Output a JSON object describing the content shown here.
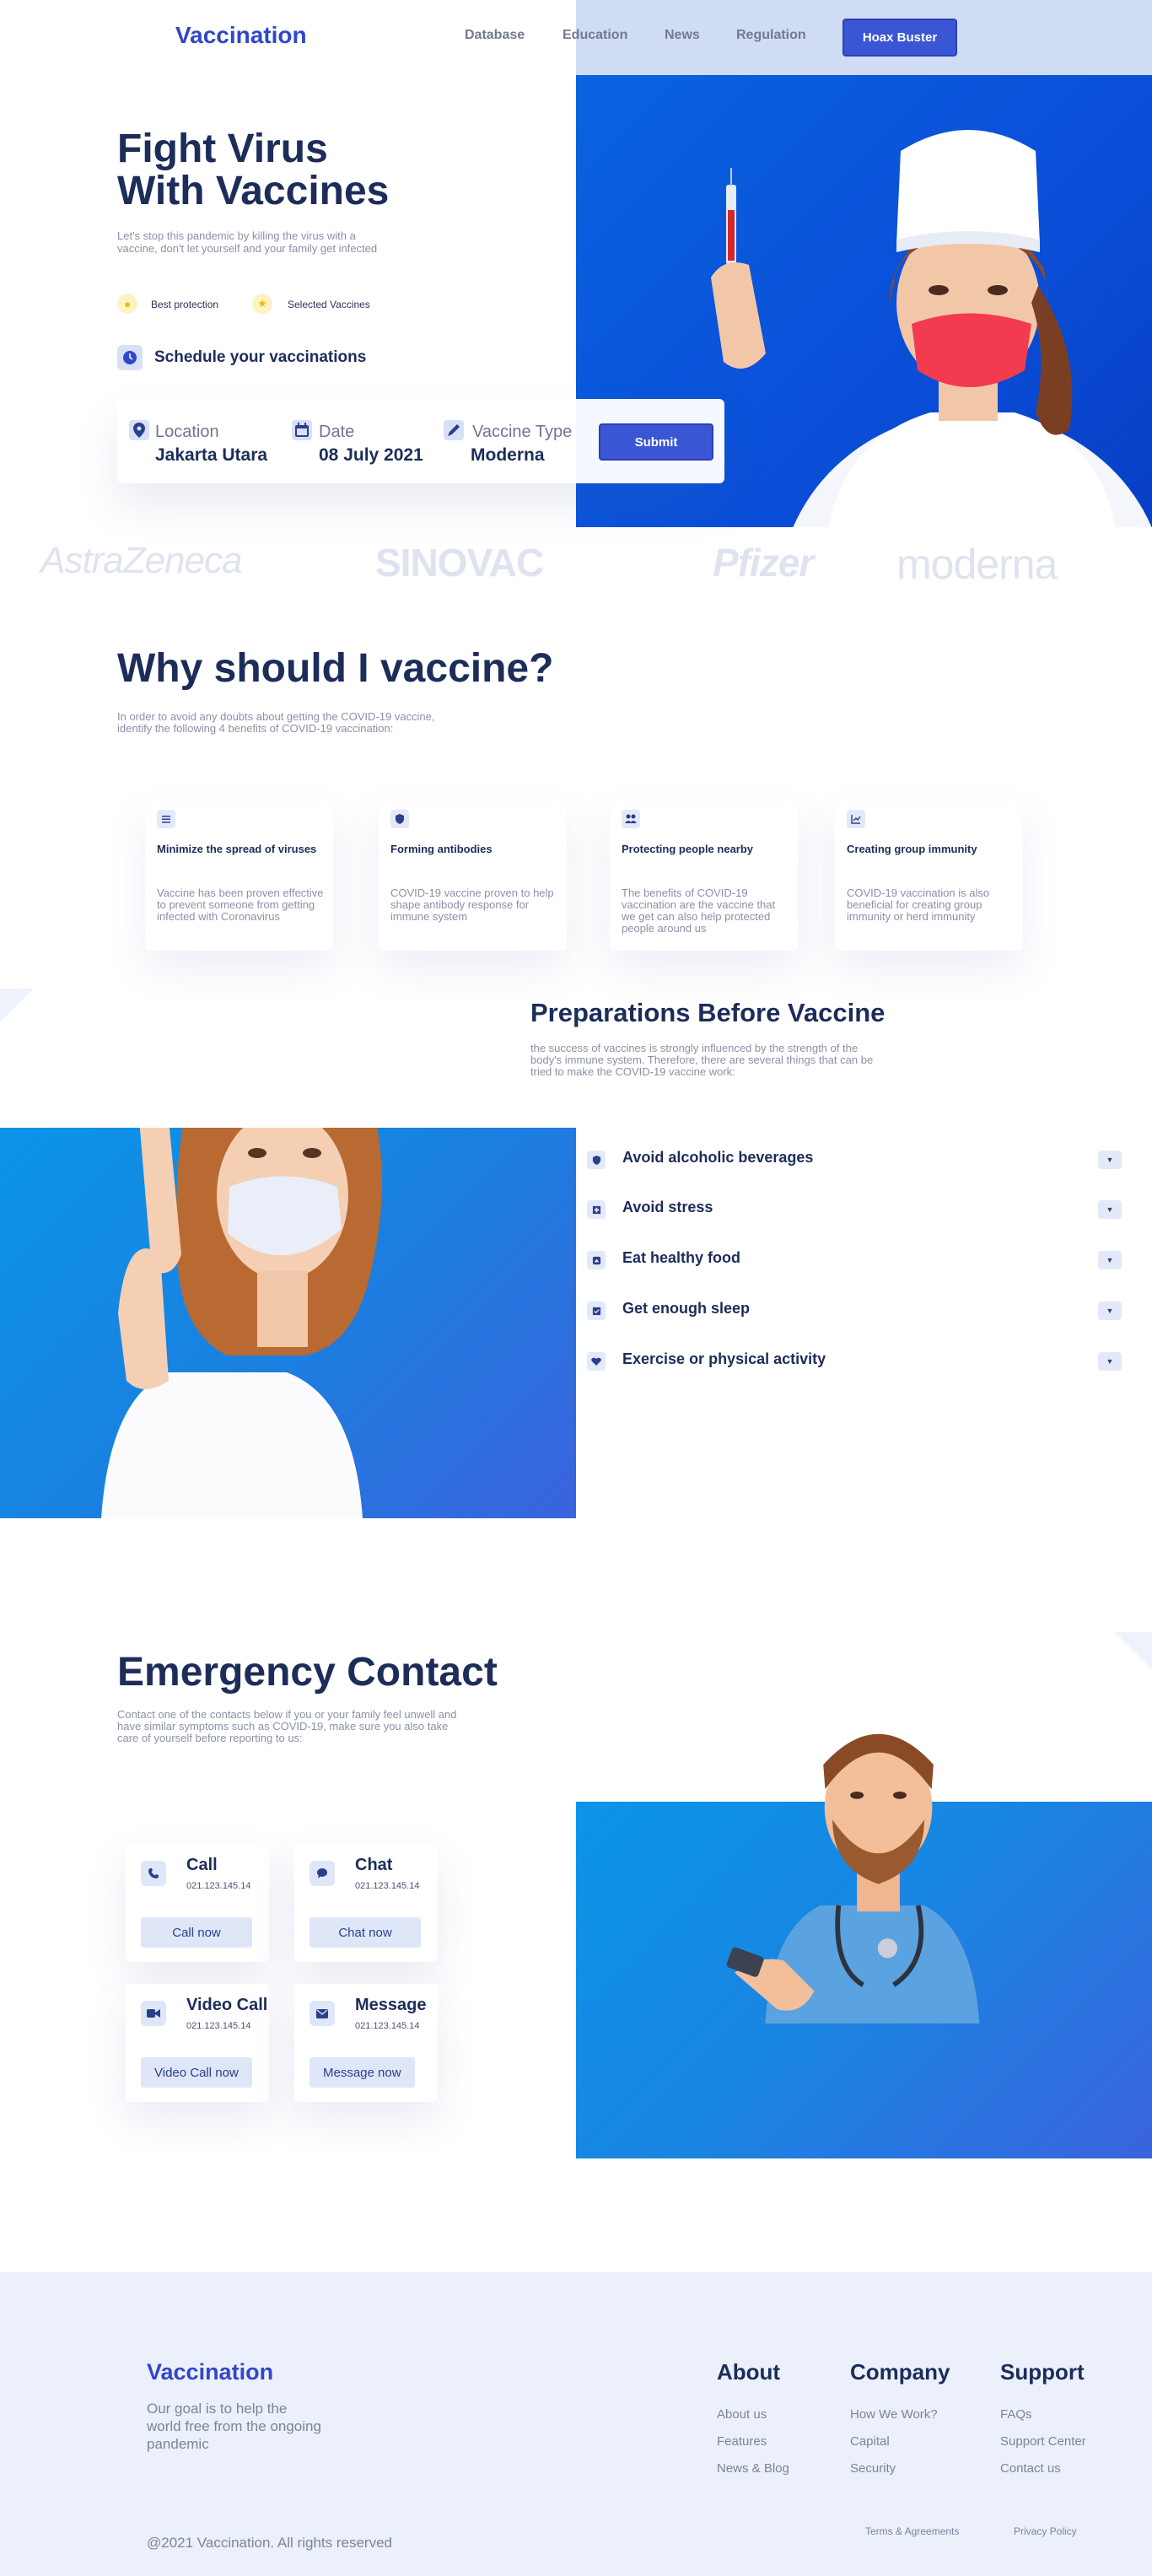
{
  "nav": {
    "logo": "Vaccination",
    "links": [
      "Database",
      "Education",
      "News",
      "Regulation"
    ],
    "cta": "Hoax Buster"
  },
  "hero": {
    "title_line1": "Fight Virus",
    "title_line2": "With Vaccines",
    "subtitle": "Let's stop this pandemic by killing the virus with a vaccine, don't let yourself and your family get infected",
    "chips": [
      "Best protection",
      "Selected Vaccines"
    ],
    "schedule": "Schedule your vaccinations",
    "form": {
      "location_label": "Location",
      "location_value": "Jakarta Utara",
      "date_label": "Date",
      "date_value": "08 July 2021",
      "type_label": "Vaccine Type",
      "type_value": "Moderna",
      "submit": "Submit"
    }
  },
  "brands": [
    "AstraZeneca",
    "SINOVAC",
    "Pfizer",
    "moderna"
  ],
  "why": {
    "title": "Why should I vaccine?",
    "subtitle": "In order to avoid any doubts about getting the COVID-19 vaccine, identify the following 4 benefits of COVID-19 vaccination:",
    "cards": [
      {
        "title": "Minimize the spread of viruses",
        "desc": "Vaccine has been proven effective to prevent someone from getting infected with Coronavirus",
        "icon": "sliders-icon"
      },
      {
        "title": "Forming antibodies",
        "desc": "COVID-19 vaccine proven to help shape antibody response for immune system",
        "icon": "shield-icon"
      },
      {
        "title": "Protecting people nearby",
        "desc": "The benefits of COVID-19 vaccination are the vaccine that we get can also help protected people around us",
        "icon": "people-icon"
      },
      {
        "title": "Creating group immunity",
        "desc": "COVID-19 vaccination is also beneficial for creating group immunity or herd immunity",
        "icon": "chart-icon"
      }
    ]
  },
  "prep": {
    "title": "Preparations Before Vaccine",
    "subtitle": "the success of vaccines is strongly influenced by the strength of the body's immune system. Therefore, there are several things that can be tried to make the COVID-19 vaccine work:",
    "items": [
      {
        "label": "Avoid alcoholic beverages",
        "icon": "shield-icon"
      },
      {
        "label": "Avoid stress",
        "icon": "plus-icon"
      },
      {
        "label": "Eat healthy food",
        "icon": "food-icon"
      },
      {
        "label": "Get enough sleep",
        "icon": "check-icon"
      },
      {
        "label": "Exercise or physical activity",
        "icon": "heart-icon"
      }
    ]
  },
  "emergency": {
    "title": "Emergency Contact",
    "subtitle": "Contact one of the contacts below if you or your family feel unwell and have similar symptoms such as COVID-19, make sure you also take care of yourself before reporting to us:",
    "contacts": [
      {
        "title": "Call",
        "number": "021.123.145.14",
        "button": "Call now",
        "icon": "phone-icon"
      },
      {
        "title": "Chat",
        "number": "021.123.145.14",
        "button": "Chat now",
        "icon": "chat-icon"
      },
      {
        "title": "Video Call",
        "number": "021.123.145.14",
        "button": "Video Call now",
        "icon": "video-icon"
      },
      {
        "title": "Message",
        "number": "021.123.145.14",
        "button": "Message now",
        "icon": "mail-icon"
      }
    ]
  },
  "footer": {
    "logo": "Vaccination",
    "tagline": "Our goal is to help the world free from the ongoing pandemic",
    "columns": [
      {
        "heading": "About",
        "links": [
          "About us",
          "Features",
          "News & Blog"
        ]
      },
      {
        "heading": "Company",
        "links": [
          "How We Work?",
          "Capital",
          "Security"
        ]
      },
      {
        "heading": "Support",
        "links": [
          "FAQs",
          "Support Center",
          "Contact us"
        ]
      }
    ],
    "copyright": "@2021 Vaccination. All rights reserved",
    "legal": [
      "Terms & Agreements",
      "Privacy Policy"
    ]
  },
  "colors": {
    "brand": "#3047c9",
    "navy": "#1d2d5a",
    "photo_blue": "#0a4ed8",
    "light_blue": "#cfdcf4",
    "footer_bg": "#ebf0fb"
  }
}
